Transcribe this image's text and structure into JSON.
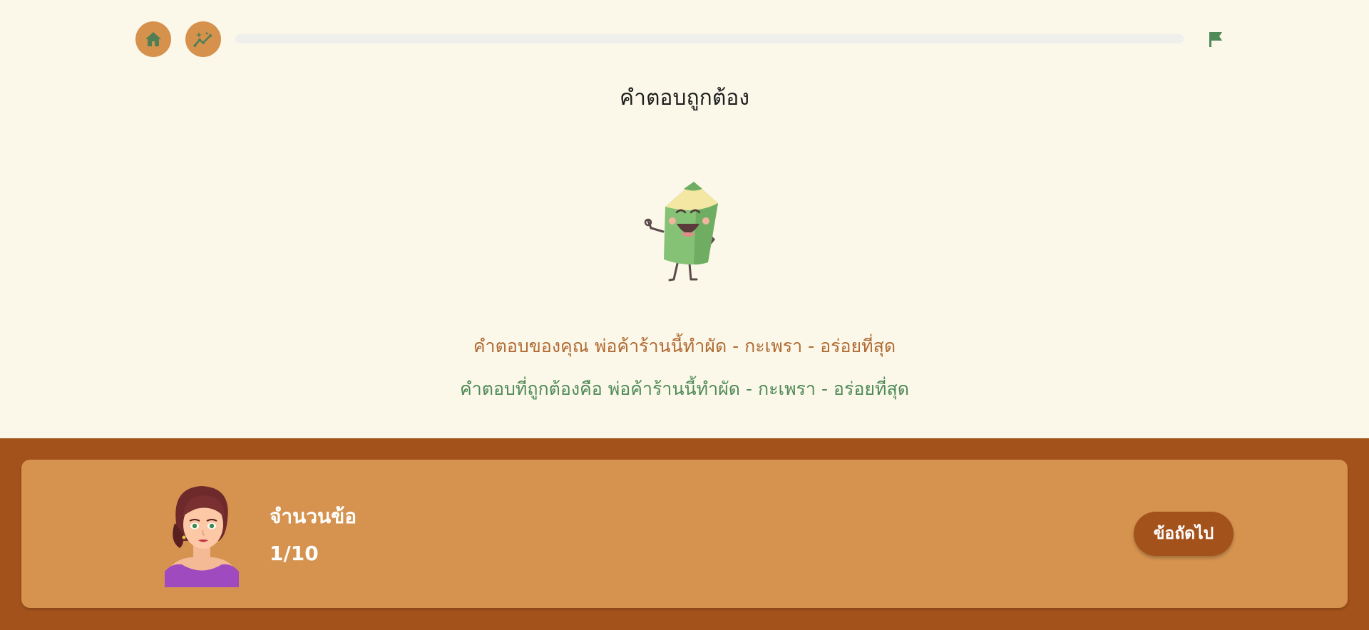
{
  "header": {
    "home_icon": "home-icon",
    "stats_icon": "chart-sparkle-icon",
    "flag_icon": "flag-icon",
    "progress": 0.0
  },
  "result": {
    "title": "คำตอบถูกต้อง",
    "your_answer": "คำตอบของคุณ พ่อค้าร้านนี้ทำผัด - กะเพรา - อร่อยที่สุด",
    "correct_answer": "คำตอบที่ถูกต้องคือ พ่อค้าร้านนี้ทำผัด - กะเพรา - อร่อยที่สุด"
  },
  "footer": {
    "count_label": "จำนวนข้อ",
    "count_value": "1/10",
    "next_label": "ข้อถัดไป"
  },
  "colors": {
    "background": "#fbf8ea",
    "accent": "#d6914d",
    "footer": "#a4521b",
    "green": "#4f8a57",
    "answer_brown": "#b06a33"
  }
}
